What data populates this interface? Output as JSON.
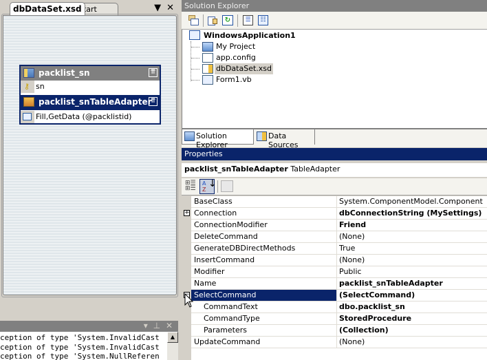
{
  "document_tabs": {
    "active": "dbDataSet.xsd",
    "inactive": "Start Page",
    "dropdown_icon": "window-list-icon",
    "close_icon": "close-icon"
  },
  "designer": {
    "table": {
      "name": "packlist_sn",
      "columns": [
        "sn"
      ],
      "key_column": "sn"
    },
    "adapter": {
      "name": "packlist_snTableAdapter",
      "queries": [
        "Fill,GetData (@packlistid)"
      ]
    },
    "collapse_glyph": "⇈"
  },
  "output": {
    "lines": [
      "ception of type 'System.InvalidCast",
      "ception of type 'System.InvalidCast",
      "ception of type 'System.NullReferen"
    ],
    "controls": [
      "▾",
      "⊥",
      "✕"
    ]
  },
  "solution_explorer": {
    "title": "Solution Explorer",
    "tree": {
      "root": "WindowsApplication1",
      "children": [
        "My Project",
        "app.config",
        "dbDataSet.xsd",
        "Form1.vb"
      ],
      "selected": "dbDataSet.xsd"
    },
    "bottom_tabs": [
      "Solution Explorer",
      "Data Sources"
    ]
  },
  "properties": {
    "title": "Properties",
    "object_name": "packlist_snTableAdapter",
    "object_type": "TableAdapter",
    "rows": [
      {
        "name": "BaseClass",
        "value": "System.ComponentModel.Component",
        "bold": false
      },
      {
        "name": "Connection",
        "value": "dbConnectionString (MySettings)",
        "bold": true,
        "expand": "+"
      },
      {
        "name": "ConnectionModifier",
        "value": "Friend",
        "bold": true
      },
      {
        "name": "DeleteCommand",
        "value": "(None)",
        "bold": false
      },
      {
        "name": "GenerateDBDirectMethods",
        "value": "True",
        "bold": false
      },
      {
        "name": "InsertCommand",
        "value": "(None)",
        "bold": false
      },
      {
        "name": "Modifier",
        "value": "Public",
        "bold": false
      },
      {
        "name": "Name",
        "value": "packlist_snTableAdapter",
        "bold": true
      },
      {
        "name": "SelectCommand",
        "value": "(SelectCommand)",
        "bold": true,
        "expand": "-",
        "selected": true
      },
      {
        "name": "CommandText",
        "value": "dbo.packlist_sn",
        "bold": true,
        "sub": true
      },
      {
        "name": "CommandType",
        "value": "StoredProcedure",
        "bold": true,
        "sub": true
      },
      {
        "name": "Parameters",
        "value": "(Collection)",
        "bold": true,
        "sub": true
      },
      {
        "name": "UpdateCommand",
        "value": "(None)",
        "bold": false
      }
    ]
  }
}
